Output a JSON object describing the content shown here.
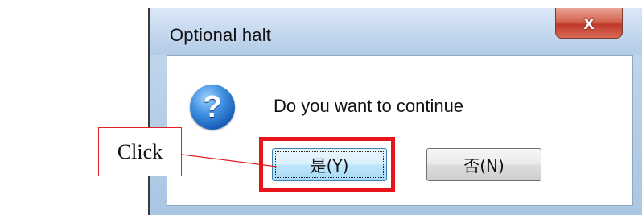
{
  "dialog": {
    "title": "Optional halt",
    "close_glyph": "x",
    "message": "Do you want to continue",
    "icon": "question-icon",
    "icon_glyph": "?",
    "buttons": {
      "yes_label": "是(Y)",
      "no_label": "否(N)"
    }
  },
  "annotation": {
    "label": "Click",
    "highlight_color": "#e8141c"
  }
}
